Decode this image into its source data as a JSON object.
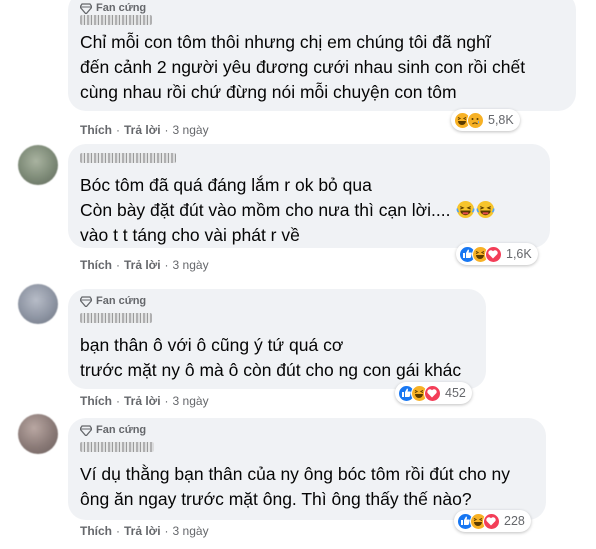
{
  "comments": [
    {
      "badge": "Fan cứng",
      "lines": [
        "Chỉ mỗi con tôm thôi nhưng chị em chúng tôi đã nghĩ",
        "đến cảnh 2 người yêu đương cưới nhau sinh con rồi chết",
        "cùng nhau rồi chứ đừng nói mỗi chuyện con tôm"
      ],
      "like": "Thích",
      "reply": "Trả lời",
      "time": "3 ngày",
      "reaction_icons": [
        "haha-icon",
        "sad-icon"
      ],
      "reaction_count": "5,8K"
    },
    {
      "badge": "",
      "lines": [
        "Bóc tôm đã quá đáng lắm r ok bỏ qua",
        "Còn bày đặt đút vào mồm cho nưa thì cạn lời....",
        "vào t t táng cho vài phát r về"
      ],
      "like": "Thích",
      "reply": "Trả lời",
      "time": "3 ngày",
      "reaction_icons": [
        "like-icon",
        "haha-icon",
        "love-icon"
      ],
      "reaction_count": "1,6K"
    },
    {
      "badge": "Fan cứng",
      "lines": [
        "bạn thân ô với ô cũng ý tứ quá cơ",
        "trước mặt ny ô mà ô còn đút cho ng con gái khác"
      ],
      "like": "Thích",
      "reply": "Trả lời",
      "time": "3 ngày",
      "reaction_icons": [
        "like-icon",
        "haha-icon",
        "love-icon"
      ],
      "reaction_count": "452"
    },
    {
      "badge": "Fan cứng",
      "lines": [
        "Ví dụ thằng bạn thân của ny ông bóc tôm rồi đút cho ny",
        "ông ăn ngay trước mặt ông. Thì ông thấy thế nào?"
      ],
      "like": "Thích",
      "reply": "Trả lời",
      "time": "3 ngày",
      "reaction_icons": [
        "like-icon",
        "haha-icon",
        "love-icon"
      ],
      "reaction_count": "228"
    }
  ],
  "colors": {
    "bubble": "#f0f2f5",
    "secondary_text": "#65676b",
    "like_blue": "#1877f2",
    "haha_yellow": "#f7b125",
    "love_red": "#f33e58"
  }
}
